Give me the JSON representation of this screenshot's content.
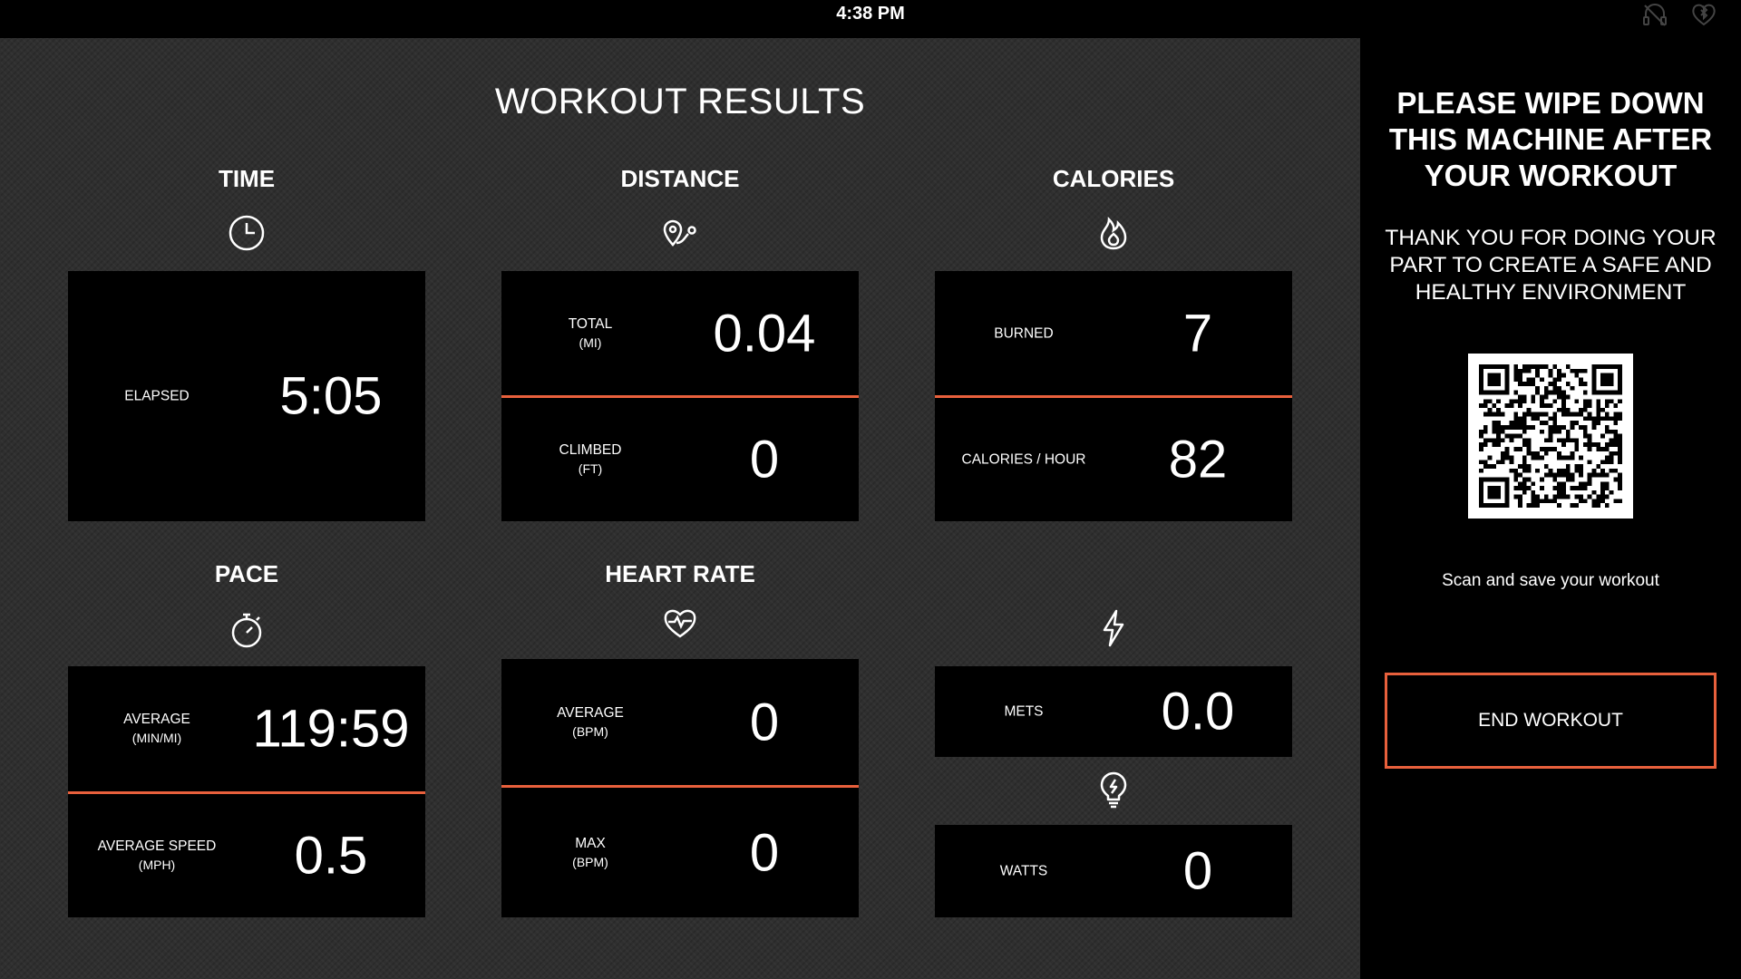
{
  "status_bar": {
    "time": "4:38 PM",
    "icons": [
      "headphones-off-icon",
      "heart-bluetooth-icon"
    ]
  },
  "main": {
    "title": "WORKOUT RESULTS",
    "sections": {
      "time": {
        "title": "TIME",
        "icon": "clock-icon",
        "rows": [
          {
            "label": "ELAPSED",
            "unit": "",
            "value": "5:05"
          }
        ]
      },
      "distance": {
        "title": "DISTANCE",
        "icon": "route-pin-icon",
        "rows": [
          {
            "label": "TOTAL",
            "unit": "(MI)",
            "value": "0.04"
          },
          {
            "label": "CLIMBED",
            "unit": "(FT)",
            "value": "0"
          }
        ]
      },
      "calories": {
        "title": "CALORIES",
        "icon": "flame-icon",
        "rows": [
          {
            "label": "BURNED",
            "unit": "",
            "value": "7"
          },
          {
            "label": "CALORIES / HOUR",
            "unit": "",
            "value": "82"
          }
        ]
      },
      "pace": {
        "title": "PACE",
        "icon": "stopwatch-icon",
        "rows": [
          {
            "label": "AVERAGE",
            "unit": "(MIN/MI)",
            "value": "119:59"
          },
          {
            "label": "AVERAGE SPEED",
            "unit": "(MPH)",
            "value": "0.5"
          }
        ]
      },
      "heart_rate": {
        "title": "HEART RATE",
        "icon": "heartbeat-icon",
        "rows": [
          {
            "label": "AVERAGE",
            "unit": "(BPM)",
            "value": "0"
          },
          {
            "label": "MAX",
            "unit": "(BPM)",
            "value": "0"
          }
        ]
      },
      "mets": {
        "icon": "lightning-bolt-icon",
        "rows": [
          {
            "label": "METS",
            "unit": "",
            "value": "0.0"
          }
        ]
      },
      "watts": {
        "icon": "lightbulb-icon",
        "rows": [
          {
            "label": "WATTS",
            "unit": "",
            "value": "0"
          }
        ]
      }
    }
  },
  "side_panel": {
    "heading": "PLEASE WIPE DOWN THIS MACHINE AFTER YOUR WORKOUT",
    "message": "THANK YOU FOR DOING YOUR PART TO CREATE A SAFE AND HEALTHY ENVIRONMENT",
    "qr_icon": "qr-code",
    "scan_text": "Scan and save your workout",
    "end_button_label": "END WORKOUT"
  },
  "colors": {
    "accent": "#e8603c",
    "panel_bg": "#2f2f2f",
    "card_bg": "#000000"
  }
}
